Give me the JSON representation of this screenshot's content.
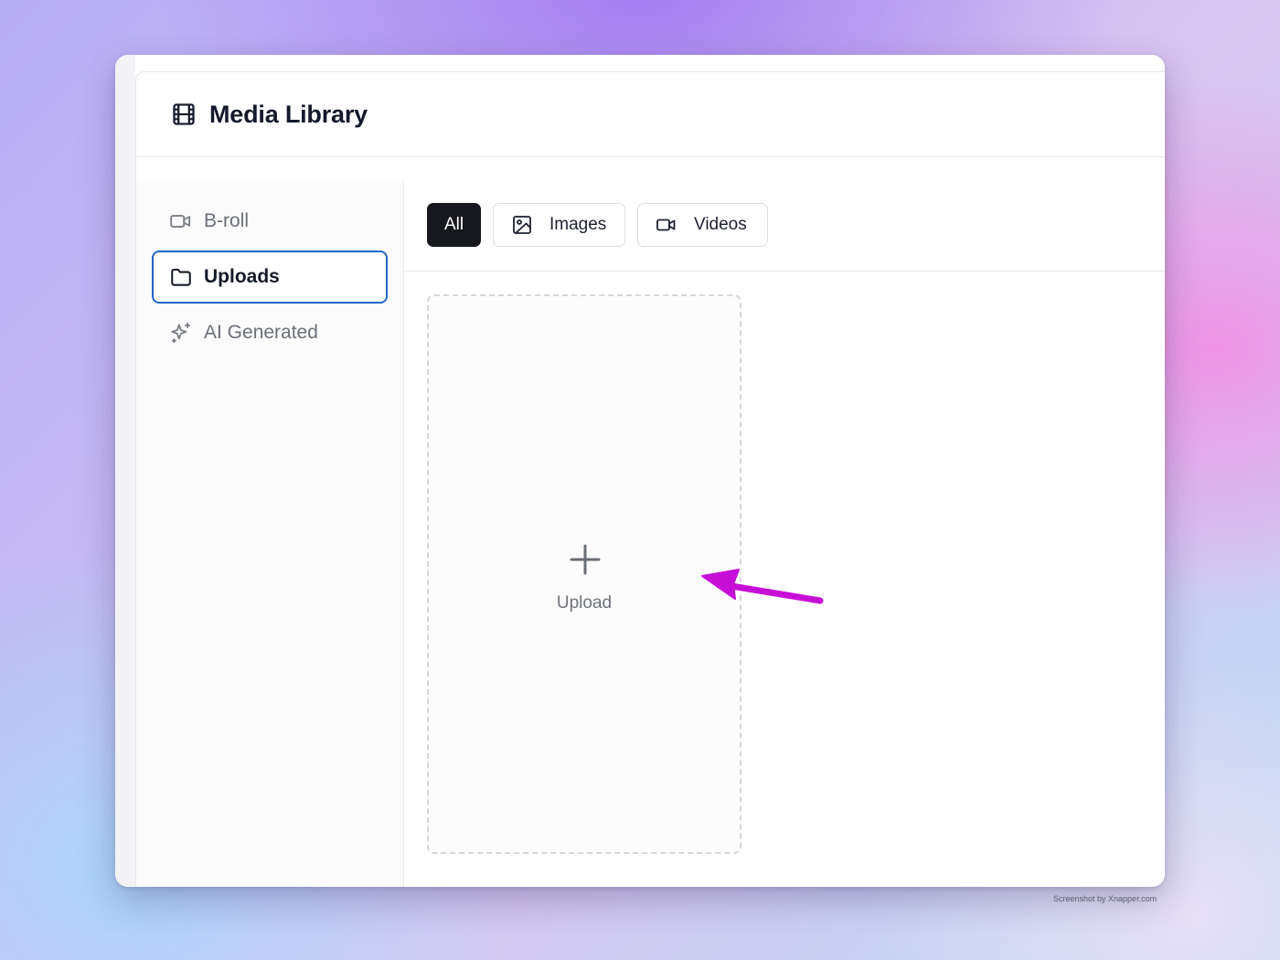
{
  "header": {
    "title": "Media Library",
    "icon": "film-icon"
  },
  "sidebar": {
    "items": [
      {
        "label": "B-roll",
        "icon": "video-camera-icon",
        "active": false
      },
      {
        "label": "Uploads",
        "icon": "folder-icon",
        "active": true
      },
      {
        "label": "AI Generated",
        "icon": "sparkles-icon",
        "active": false
      }
    ]
  },
  "filters": {
    "all_label": "All",
    "images_label": "Images",
    "videos_label": "Videos",
    "selected": "All"
  },
  "upload": {
    "label": "Upload",
    "icon": "plus-icon"
  },
  "annotation": {
    "icon": "arrow-annotation-icon",
    "color": "#c60fd6"
  },
  "watermark": "Screenshot by Xnapper.com",
  "colors": {
    "accent": "#2167c7",
    "chip_selected": "#16181d",
    "title_text": "#141a2b"
  }
}
